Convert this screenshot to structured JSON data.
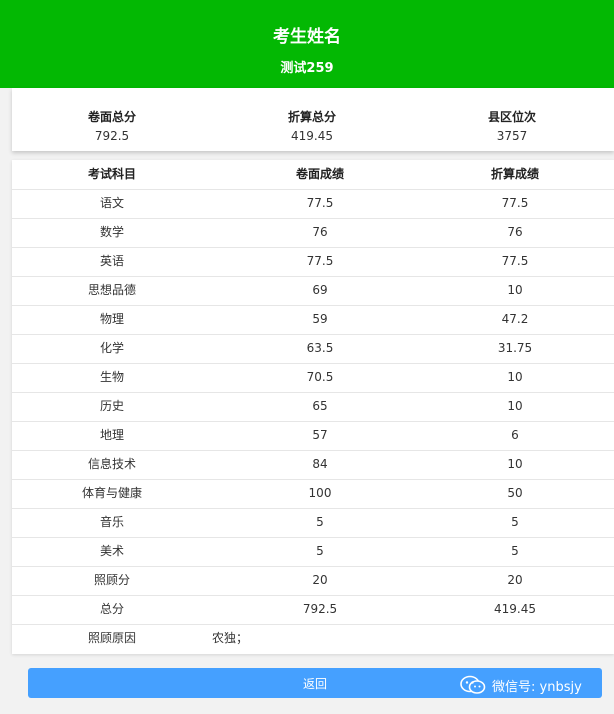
{
  "header": {
    "title": "考生姓名",
    "subtitle": "测试259"
  },
  "summary": [
    {
      "label": "卷面总分",
      "value": "792.5"
    },
    {
      "label": "折算总分",
      "value": "419.45"
    },
    {
      "label": "县区位次",
      "value": "3757"
    }
  ],
  "table": {
    "headers": [
      "考试科目",
      "卷面成绩",
      "折算成绩"
    ],
    "rows": [
      [
        "语文",
        "77.5",
        "77.5"
      ],
      [
        "数学",
        "76",
        "76"
      ],
      [
        "英语",
        "77.5",
        "77.5"
      ],
      [
        "思想品德",
        "69",
        "10"
      ],
      [
        "物理",
        "59",
        "47.2"
      ],
      [
        "化学",
        "63.5",
        "31.75"
      ],
      [
        "生物",
        "70.5",
        "10"
      ],
      [
        "历史",
        "65",
        "10"
      ],
      [
        "地理",
        "57",
        "6"
      ],
      [
        "信息技术",
        "84",
        "10"
      ],
      [
        "体育与健康",
        "100",
        "50"
      ],
      [
        "音乐",
        "5",
        "5"
      ],
      [
        "美术",
        "5",
        "5"
      ],
      [
        "照顾分",
        "20",
        "20"
      ],
      [
        "总分",
        "792.5",
        "419.45"
      ]
    ],
    "note": {
      "label": "照顾原因",
      "value": "农独；"
    }
  },
  "back_button": {
    "label": "返回"
  },
  "watermark": {
    "icon": "wechat-icon",
    "text": "微信号: ynbsjy"
  },
  "colors": {
    "header_bg": "#03b803",
    "button_bg": "#45a0ff"
  }
}
